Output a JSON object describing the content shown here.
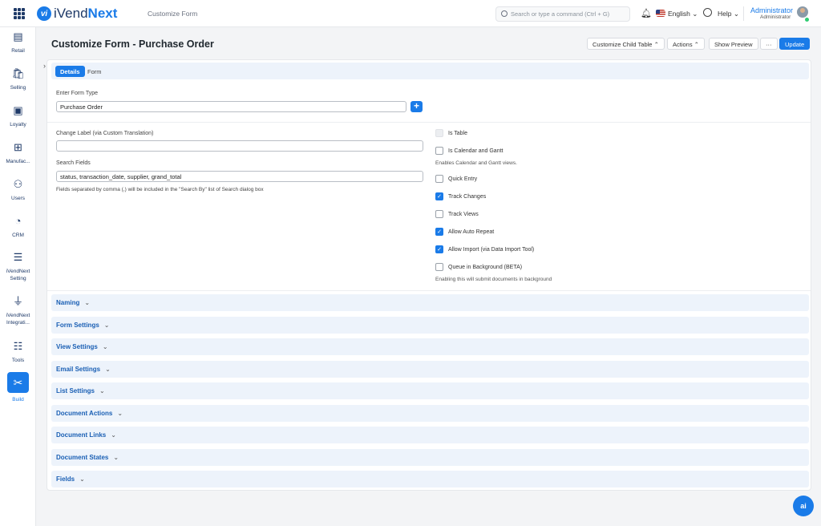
{
  "app": {
    "name_prefix": "iVend",
    "name_suffix": "Next",
    "logo_mark": "vi",
    "breadcrumb": "Customize Form"
  },
  "topbar": {
    "search_placeholder": "Search or type a command (Ctrl + G)",
    "language": "English ⌄",
    "help": "Help ⌄",
    "user_name": "Administrator",
    "user_role": "Administrator"
  },
  "sidebar": {
    "items": [
      {
        "label": "Retail",
        "icon": "▤"
      },
      {
        "label": "Selling",
        "icon": "🛍"
      },
      {
        "label": "Loyalty",
        "icon": "▣"
      },
      {
        "label": "Manufac...",
        "icon": "⊞"
      },
      {
        "label": "Users",
        "icon": "⚇"
      },
      {
        "label": "CRM",
        "icon": "◔"
      },
      {
        "label": "iVendNext Setting",
        "icon": "☰"
      },
      {
        "label": "iVendNext Integrati...",
        "icon": "⏚"
      },
      {
        "label": "Tools",
        "icon": "☷"
      },
      {
        "label": "Build",
        "icon": "✂"
      }
    ]
  },
  "page": {
    "title": "Customize Form - Purchase Order",
    "buttons": {
      "child_table": "Customize Child Table ⌃",
      "actions": "Actions ⌃",
      "preview": "Show Preview",
      "more": "···",
      "update": "Update"
    }
  },
  "tabs": [
    "Details",
    "Form"
  ],
  "form": {
    "form_type_label": "Enter Form Type",
    "form_type_value": "Purchase Order",
    "change_label_label": "Change Label (via Custom Translation)",
    "change_label_value": "",
    "search_fields_label": "Search Fields",
    "search_fields_value": "status, transaction_date, supplier, grand_total",
    "search_fields_help": "Fields separated by comma (,) will be included in the \"Search By\" list of Search dialog box"
  },
  "checkboxes": [
    {
      "label": "Is Table",
      "checked": false,
      "disabled": true
    },
    {
      "label": "Is Calendar and Gantt",
      "checked": false,
      "desc": "Enables Calendar and Gantt views."
    },
    {
      "label": "Quick Entry",
      "checked": false
    },
    {
      "label": "Track Changes",
      "checked": true
    },
    {
      "label": "Track Views",
      "checked": false
    },
    {
      "label": "Allow Auto Repeat",
      "checked": true
    },
    {
      "label": "Allow Import (via Data Import Tool)",
      "checked": true
    },
    {
      "label": "Queue in Background (BETA)",
      "checked": false,
      "desc": "Enabling this will submit documents in background"
    }
  ],
  "sections": [
    "Naming",
    "Form Settings",
    "View Settings",
    "Email Settings",
    "List Settings",
    "Document Actions",
    "Document Links",
    "Document States",
    "Fields"
  ],
  "ai_button": "ai"
}
